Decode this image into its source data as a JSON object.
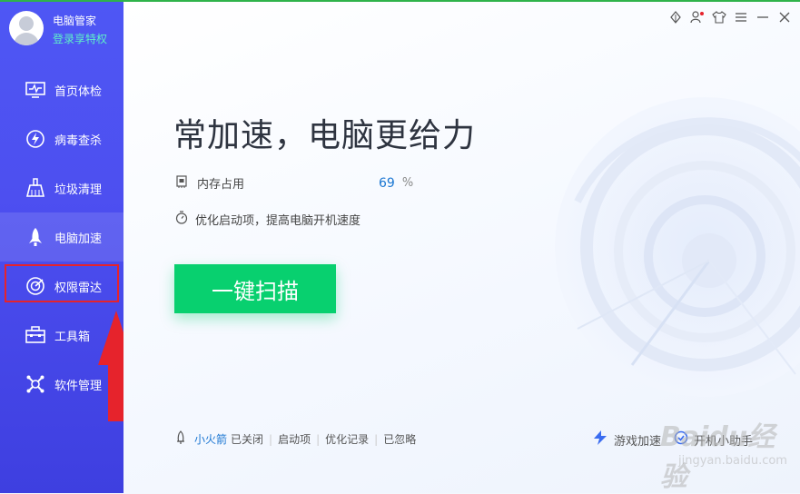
{
  "app": {
    "name": "电脑管家",
    "login_text": "登录享特权"
  },
  "sidebar": {
    "items": [
      {
        "label": "首页体检",
        "icon": "monitor-pulse-icon"
      },
      {
        "label": "病毒查杀",
        "icon": "bolt-shield-icon"
      },
      {
        "label": "垃圾清理",
        "icon": "broom-icon"
      },
      {
        "label": "电脑加速",
        "icon": "rocket-icon"
      },
      {
        "label": "权限雷达",
        "icon": "radar-icon"
      },
      {
        "label": "工具箱",
        "icon": "toolbox-icon"
      },
      {
        "label": "软件管理",
        "icon": "software-icon"
      }
    ],
    "active_index": 3,
    "highlighted_index": 4
  },
  "main": {
    "headline": "常加速，电脑更给力",
    "memory": {
      "label": "内存占用",
      "value": "69",
      "unit": "%"
    },
    "optimize_text": "优化启动项，提高电脑开机速度",
    "scan_button": "一键扫描",
    "bottom_bar": {
      "rocket_label": "小火箭",
      "rocket_status": "已关闭",
      "startup": "启动项",
      "history": "优化记录",
      "ignored": "已忽略"
    },
    "bottom_right": {
      "game_label": "游戏加速",
      "boot_label": "开机小助手"
    }
  },
  "watermark": {
    "text": "Baidu经验",
    "url": "jingyan.baidu.com"
  },
  "colors": {
    "sidebar": "#4e57f4",
    "accent_green": "#08d06f",
    "link_blue": "#1a76d2",
    "highlight_red": "#e6232c"
  }
}
